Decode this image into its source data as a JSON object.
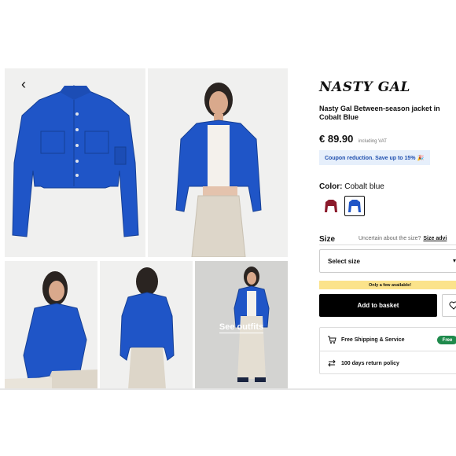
{
  "gallery": {
    "back_icon": "chevron-left-icon",
    "see_outfits_label": "See outfits"
  },
  "product": {
    "brand_logo": "NASTY GAL",
    "title": "Nasty Gal Between-season jacket in Cobalt Blue",
    "price": "€ 89.90",
    "vat_note": "including VAT",
    "coupon_text": "Coupon reduction. Save up to 15% 🎉",
    "color_label": "Color:",
    "color_value": "Cobalt blue",
    "swatches": [
      {
        "name": "burgundy",
        "color": "#8b1a2b"
      },
      {
        "name": "cobalt-blue",
        "color": "#1f55c7"
      }
    ],
    "size_label": "Size",
    "size_hint": "Uncertain about the size?",
    "size_advice": "Size advi",
    "select_placeholder": "Select size",
    "stock_note": "Only a few available!",
    "basket_label": "Add to basket",
    "shipping_text": "Free Shipping & Service",
    "free_badge": "Free",
    "returns_text": "100 days return policy"
  },
  "colors": {
    "jacket": "#1f55c7",
    "badge_green": "#1f8a4c",
    "coupon_bg": "#e6effb",
    "stock_bg": "#fbe38b"
  }
}
